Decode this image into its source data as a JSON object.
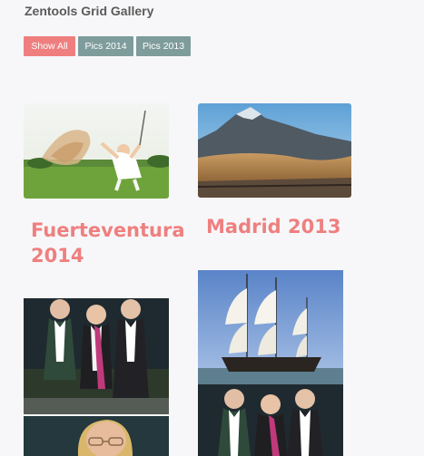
{
  "header": {
    "title": "Zentools Grid Gallery"
  },
  "filters": {
    "show_all": "Show All",
    "pics_2014": "Pics 2014",
    "pics_2013": "Pics 2013"
  },
  "gallery": {
    "items": [
      {
        "caption_line1": "Fuerteventura",
        "caption_line2": "2014",
        "image": "golfer"
      },
      {
        "caption": "Madrid 2013",
        "image": "volcano-landscape"
      },
      {
        "image": "group-of-women"
      },
      {
        "image": "tall-ship"
      },
      {
        "image": "group-of-women"
      },
      {
        "image": "woman-portrait"
      }
    ]
  },
  "colors": {
    "accent": "#ef7f7f",
    "filter_idle": "#7f9c9c",
    "background": "#f7f7f9"
  }
}
